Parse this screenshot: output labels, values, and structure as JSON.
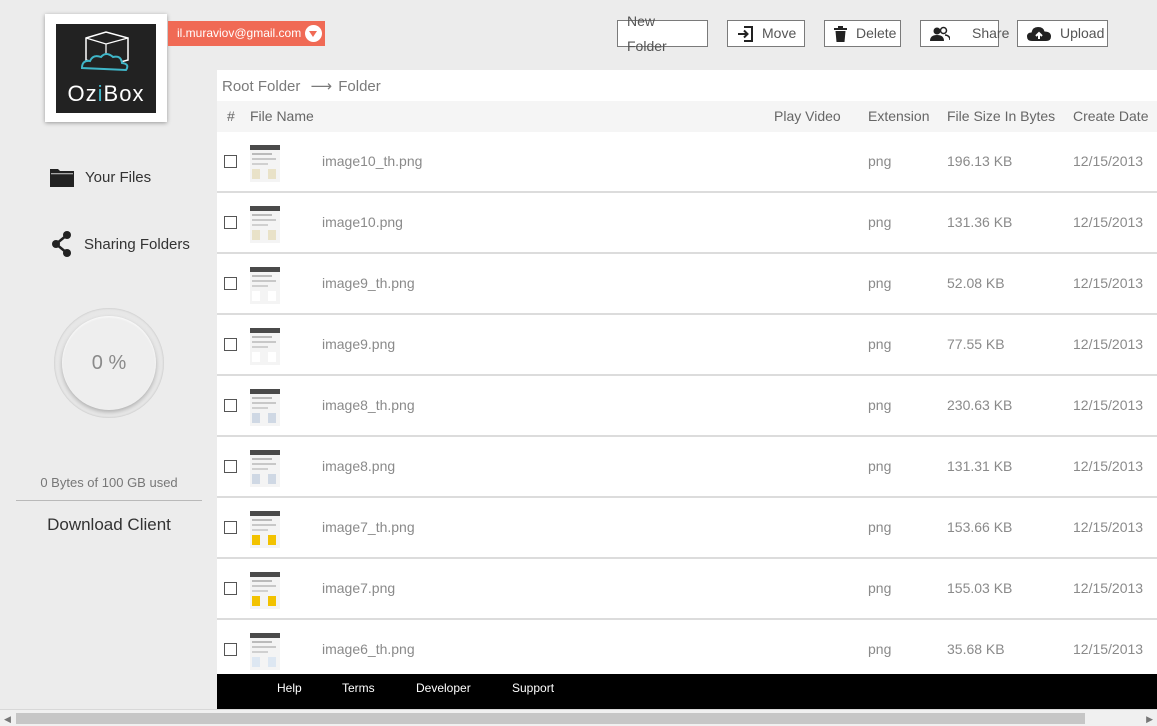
{
  "app": {
    "logo_text_pre": "Oz",
    "logo_text_i": "i",
    "logo_text_post": "Box"
  },
  "account": {
    "email": "il.muraviov@gmail.com"
  },
  "toolbar": {
    "new_folder": "New Folder",
    "move": "Move",
    "delete": "Delete",
    "share": "Share",
    "upload": "Upload"
  },
  "sidebar": {
    "your_files": "Your Files",
    "sharing_folders": "Sharing Folders",
    "usage_percent": "0 %",
    "usage_text": "0 Bytes of 100 GB used",
    "download_client": "Download Client"
  },
  "breadcrumb": {
    "root": "Root Folder",
    "arrow": "⟶",
    "current": "Folder"
  },
  "table": {
    "headers": {
      "index": "#",
      "file_name": "File Name",
      "play_video": "Play Video",
      "extension": "Extension",
      "size": "File Size In Bytes",
      "date": "Create Date"
    },
    "rows": [
      {
        "name": "image10_th.png",
        "ext": "png",
        "size": "196.13 KB",
        "date": "12/15/2013"
      },
      {
        "name": "image10.png",
        "ext": "png",
        "size": "131.36 KB",
        "date": "12/15/2013"
      },
      {
        "name": "image9_th.png",
        "ext": "png",
        "size": "52.08 KB",
        "date": "12/15/2013"
      },
      {
        "name": "image9.png",
        "ext": "png",
        "size": "77.55 KB",
        "date": "12/15/2013"
      },
      {
        "name": "image8_th.png",
        "ext": "png",
        "size": "230.63 KB",
        "date": "12/15/2013"
      },
      {
        "name": "image8.png",
        "ext": "png",
        "size": "131.31 KB",
        "date": "12/15/2013"
      },
      {
        "name": "image7_th.png",
        "ext": "png",
        "size": "153.66 KB",
        "date": "12/15/2013"
      },
      {
        "name": "image7.png",
        "ext": "png",
        "size": "155.03 KB",
        "date": "12/15/2013"
      },
      {
        "name": "image6_th.png",
        "ext": "png",
        "size": "35.68 KB",
        "date": "12/15/2013"
      }
    ]
  },
  "footer": {
    "help": "Help",
    "terms": "Terms",
    "developer": "Developer",
    "support": "Support"
  },
  "colors": {
    "accent": "#f06a55",
    "logo_bg": "#222222",
    "logo_accent": "#3fb6c8"
  }
}
